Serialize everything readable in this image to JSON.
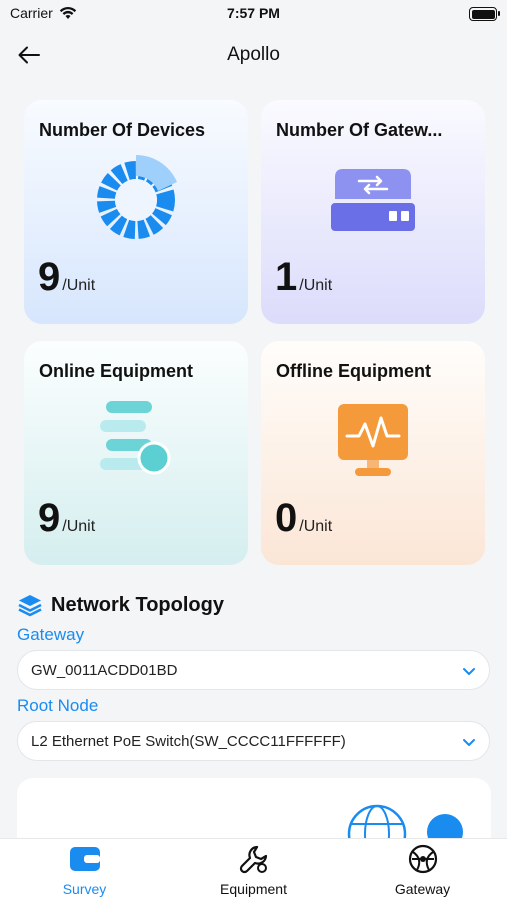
{
  "status_bar": {
    "carrier": "Carrier",
    "time": "7:57 PM"
  },
  "nav": {
    "title": "Apollo",
    "back_icon": "arrow-left-icon"
  },
  "cards": [
    {
      "title": "Number Of Devices",
      "value": "9",
      "unit": "/Unit",
      "icon": "donut-chart-icon"
    },
    {
      "title": "Number Of Gatew...",
      "value": "1",
      "unit": "/Unit",
      "icon": "gateway-device-icon"
    },
    {
      "title": "Online Equipment",
      "value": "9",
      "unit": "/Unit",
      "icon": "online-equipment-icon"
    },
    {
      "title": "Offline Equipment",
      "value": "0",
      "unit": "/Unit",
      "icon": "monitor-pulse-icon"
    }
  ],
  "topology": {
    "title": "Network Topology",
    "gateway_label": "Gateway",
    "gateway_value": "GW_0011ACDD01BD",
    "root_node_label": "Root Node",
    "root_node_value": "L2 Ethernet PoE Switch(SW_CCCC11FFFFFF)"
  },
  "tabs": [
    {
      "label": "Survey",
      "active": true,
      "icon": "survey-icon"
    },
    {
      "label": "Equipment",
      "active": false,
      "icon": "wrench-icon"
    },
    {
      "label": "Gateway",
      "active": false,
      "icon": "globe-icon"
    }
  ],
  "colors": {
    "accent": "#1a8cf0",
    "devices_icon": "#1a8cf0",
    "gateway_icon": "#6a6fe8",
    "online_icon": "#5ccfd2",
    "offline_icon": "#f59a3a"
  }
}
